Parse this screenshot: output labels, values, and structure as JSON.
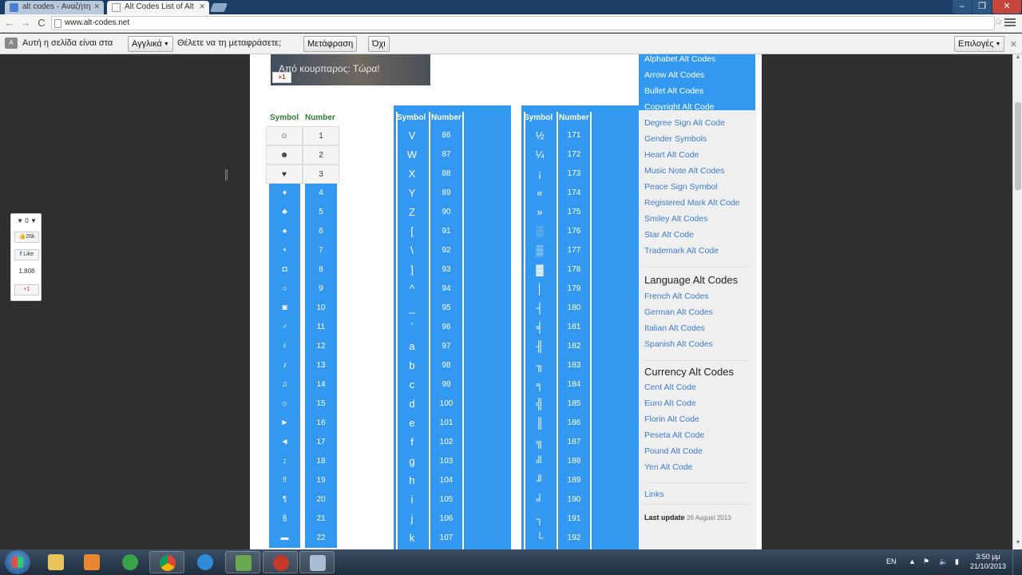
{
  "browser": {
    "tabs": [
      {
        "title": "alt codes - Αναζήτη",
        "active": false
      },
      {
        "title": "Alt Codes List of Alt",
        "active": true
      }
    ],
    "url": "www.alt-codes.net",
    "window_controls": [
      "–",
      "❐",
      "✕"
    ]
  },
  "translate_bar": {
    "prompt": "Αυτή η σελίδα είναι στα",
    "language": "Αγγλικά",
    "question": "Θέλετε να τη μεταφράσετε;",
    "translate_button": "Μετάφραση",
    "no_button": "Όχι",
    "options_button": "Επιλογές"
  },
  "ad": {
    "caption": "Από κουρπαρος: Τώρα!",
    "badge": "+1"
  },
  "social": {
    "votes": "0",
    "likes": "26k",
    "fb_like": "Like",
    "count": "1.808",
    "gplus": "+1"
  },
  "table1": {
    "headers": {
      "symbol": "Symbol",
      "number": "Number"
    },
    "rows": [
      {
        "s": "☺",
        "n": "1"
      },
      {
        "s": "☻",
        "n": "2"
      },
      {
        "s": "♥",
        "n": "3"
      },
      {
        "s": "♦",
        "n": "4"
      },
      {
        "s": "♣",
        "n": "5"
      },
      {
        "s": "♠",
        "n": "6"
      },
      {
        "s": "•",
        "n": "7"
      },
      {
        "s": "◘",
        "n": "8"
      },
      {
        "s": "○",
        "n": "9"
      },
      {
        "s": "◙",
        "n": "10"
      },
      {
        "s": "♂",
        "n": "11"
      },
      {
        "s": "♀",
        "n": "12"
      },
      {
        "s": "♪",
        "n": "13"
      },
      {
        "s": "♫",
        "n": "14"
      },
      {
        "s": "☼",
        "n": "15"
      },
      {
        "s": "►",
        "n": "16"
      },
      {
        "s": "◄",
        "n": "17"
      },
      {
        "s": "↕",
        "n": "18"
      },
      {
        "s": "‼",
        "n": "19"
      },
      {
        "s": "¶",
        "n": "20"
      },
      {
        "s": "§",
        "n": "21"
      },
      {
        "s": "▬",
        "n": "22"
      }
    ]
  },
  "table2": {
    "headers": {
      "symbol": "Symbol",
      "number": "Number"
    },
    "rows": [
      {
        "s": "V",
        "n": "86"
      },
      {
        "s": "W",
        "n": "87"
      },
      {
        "s": "X",
        "n": "88"
      },
      {
        "s": "Y",
        "n": "89"
      },
      {
        "s": "Z",
        "n": "90"
      },
      {
        "s": "[",
        "n": "91"
      },
      {
        "s": "\\",
        "n": "92"
      },
      {
        "s": "]",
        "n": "93"
      },
      {
        "s": "^",
        "n": "94"
      },
      {
        "s": "_",
        "n": "95"
      },
      {
        "s": "`",
        "n": "96"
      },
      {
        "s": "a",
        "n": "97"
      },
      {
        "s": "b",
        "n": "98"
      },
      {
        "s": "c",
        "n": "99"
      },
      {
        "s": "d",
        "n": "100"
      },
      {
        "s": "e",
        "n": "101"
      },
      {
        "s": "f",
        "n": "102"
      },
      {
        "s": "g",
        "n": "103"
      },
      {
        "s": "h",
        "n": "104"
      },
      {
        "s": "i",
        "n": "105"
      },
      {
        "s": "j",
        "n": "106"
      },
      {
        "s": "k",
        "n": "107"
      }
    ]
  },
  "table3": {
    "headers": {
      "symbol": "Symbol",
      "number": "Number"
    },
    "rows": [
      {
        "s": "½",
        "n": "171"
      },
      {
        "s": "¼",
        "n": "172"
      },
      {
        "s": "¡",
        "n": "173"
      },
      {
        "s": "«",
        "n": "174"
      },
      {
        "s": "»",
        "n": "175"
      },
      {
        "s": "░",
        "n": "176"
      },
      {
        "s": "▒",
        "n": "177"
      },
      {
        "s": "▓",
        "n": "178"
      },
      {
        "s": "│",
        "n": "179"
      },
      {
        "s": "┤",
        "n": "180"
      },
      {
        "s": "╡",
        "n": "181"
      },
      {
        "s": "╢",
        "n": "182"
      },
      {
        "s": "╖",
        "n": "183"
      },
      {
        "s": "╕",
        "n": "184"
      },
      {
        "s": "╣",
        "n": "185"
      },
      {
        "s": "║",
        "n": "186"
      },
      {
        "s": "╗",
        "n": "187"
      },
      {
        "s": "╝",
        "n": "188"
      },
      {
        "s": "╜",
        "n": "189"
      },
      {
        "s": "╛",
        "n": "190"
      },
      {
        "s": "┐",
        "n": "191"
      },
      {
        "s": "└",
        "n": "192"
      }
    ]
  },
  "sidebar": {
    "selected_links": [
      "Alphabet Alt Codes",
      "Arrow Alt Codes",
      "Bullet Alt Codes",
      "Copyright Alt Code"
    ],
    "links": [
      "Degree Sign Alt Code",
      "Gender Symbols",
      "Heart Alt Code",
      "Music Note Alt Codes",
      "Peace Sign Symbol",
      "Registered Mark Alt Code",
      "Smiley Alt Codes",
      "Star Alt Code",
      "Trademark Alt Code"
    ],
    "language_heading": "Language Alt Codes",
    "language_links": [
      "French Alt Codes",
      "German Alt Codes",
      "Italian Alt Codes",
      "Spanish Alt Codes"
    ],
    "currency_heading": "Currency Alt Codes",
    "currency_links": [
      "Cent Alt Code",
      "Euro Alt Code",
      "Florin Alt Code",
      "Peseta Alt Code",
      "Pound Alt Code",
      "Yen Alt Code"
    ],
    "links_label": "Links",
    "last_update_label": "Last update",
    "last_update_value": "26 August 2013"
  },
  "taskbar": {
    "lang": "EN",
    "time": "3:50 μμ",
    "date": "21/10/2013"
  }
}
